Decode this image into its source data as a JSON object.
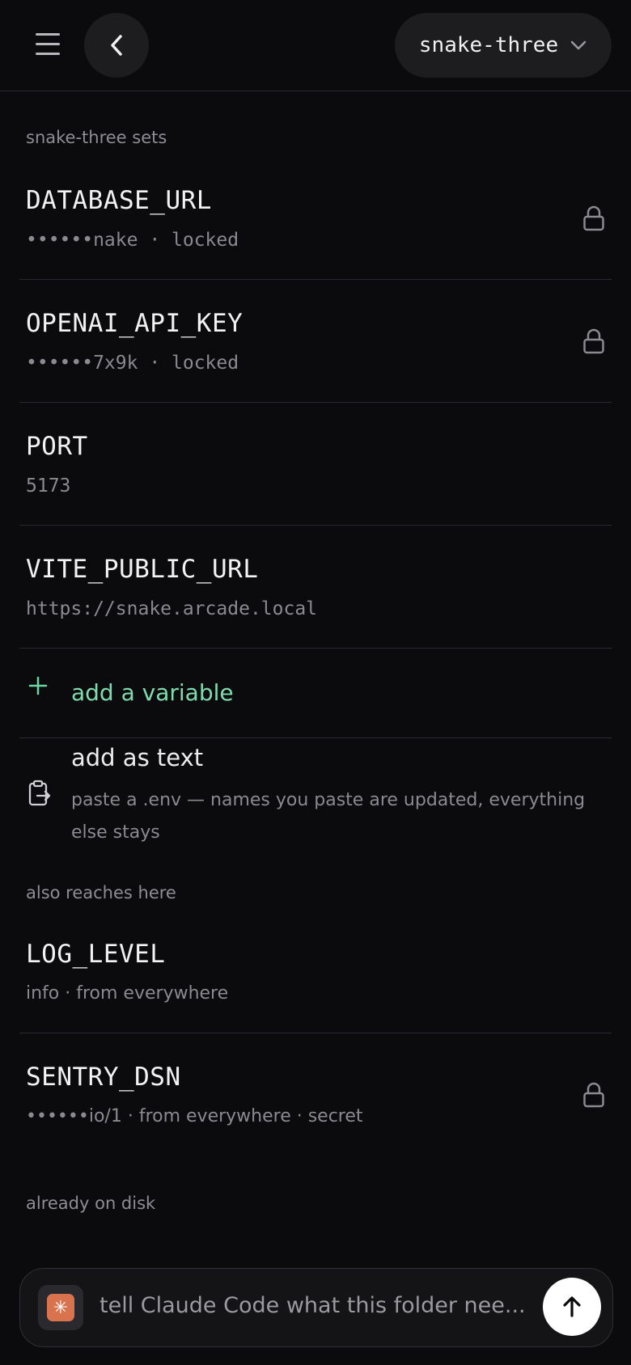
{
  "header": {
    "project_name": "snake-three"
  },
  "sections": {
    "sets_label": "snake-three sets",
    "reaches_label": "also reaches here",
    "disk_label": "already on disk"
  },
  "variables": [
    {
      "name": "DATABASE_URL",
      "detail": "••••••nake · locked",
      "locked": true
    },
    {
      "name": "OPENAI_API_KEY",
      "detail": "••••••7x9k · locked",
      "locked": true
    },
    {
      "name": "PORT",
      "detail": "5173",
      "locked": false
    },
    {
      "name": "VITE_PUBLIC_URL",
      "detail": "https://snake.arcade.local",
      "locked": false
    }
  ],
  "add_variable": {
    "label": "add a variable"
  },
  "add_text": {
    "title": "add as text",
    "description": "paste a .env — names you paste are updated, everything else stays"
  },
  "inherited": [
    {
      "name": "LOG_LEVEL",
      "detail": "info · from everywhere",
      "locked": false
    },
    {
      "name": "SENTRY_DSN",
      "detail": "••••••io/1 · from everywhere · secret",
      "locked": true
    }
  ],
  "composer": {
    "placeholder": "tell Claude Code what this folder nee..."
  },
  "colors": {
    "background": "#0b0b0d",
    "accent_green": "#7fdcb0",
    "claude_orange": "#d9734e"
  }
}
